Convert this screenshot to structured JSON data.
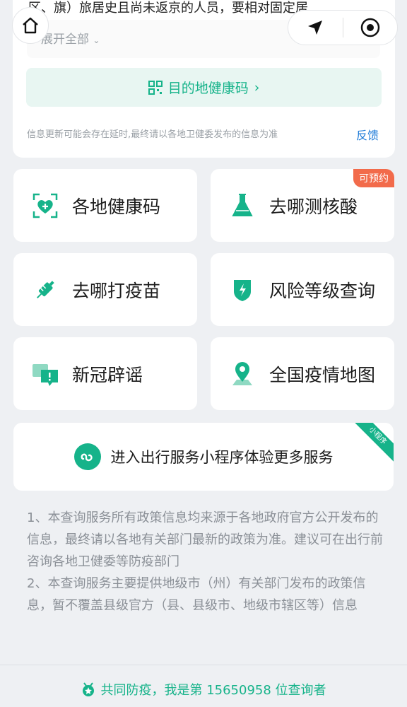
{
  "colors": {
    "accent": "#16b38a",
    "link": "#1e7bd8",
    "badge": "#f26b4b"
  },
  "top_card": {
    "policy_text": "区、旗）旅居史且尚未返京的人员，要相对固定居",
    "expand_label": "展开全部",
    "qr_button_label": "目的地健康码",
    "disclaimer": "信息更新可能会存在延时,最终请以各地卫健委发布的信息为准",
    "feedback_label": "反馈"
  },
  "tiles": [
    {
      "label": "各地健康码",
      "icon": "health-code-icon"
    },
    {
      "label": "去哪测核酸",
      "icon": "flask-icon",
      "badge": "可预约"
    },
    {
      "label": "去哪打疫苗",
      "icon": "syringe-icon"
    },
    {
      "label": "风险等级查询",
      "icon": "shield-bolt-icon"
    },
    {
      "label": "新冠辟谣",
      "icon": "chat-alert-icon"
    },
    {
      "label": "全国疫情地图",
      "icon": "map-pin-icon"
    }
  ],
  "mini_program": {
    "label": "进入出行服务小程序体验更多服务",
    "ribbon": "小程序"
  },
  "notes": {
    "note1": "1、本查询服务所有政策信息均来源于各地政府官方公开发布的信息，最终请以各地有关部门最新的政策为准。建议可在出行前咨询各地卫健委等防疫部门",
    "note2": "2、本查询服务主要提供地级市（州）有关部门发布的政策信息，暂不覆盖县级官方（县、县级市、地级市辖区等）信息"
  },
  "footer": {
    "text": "共同防疫，我是第 15650958 位查询者"
  }
}
